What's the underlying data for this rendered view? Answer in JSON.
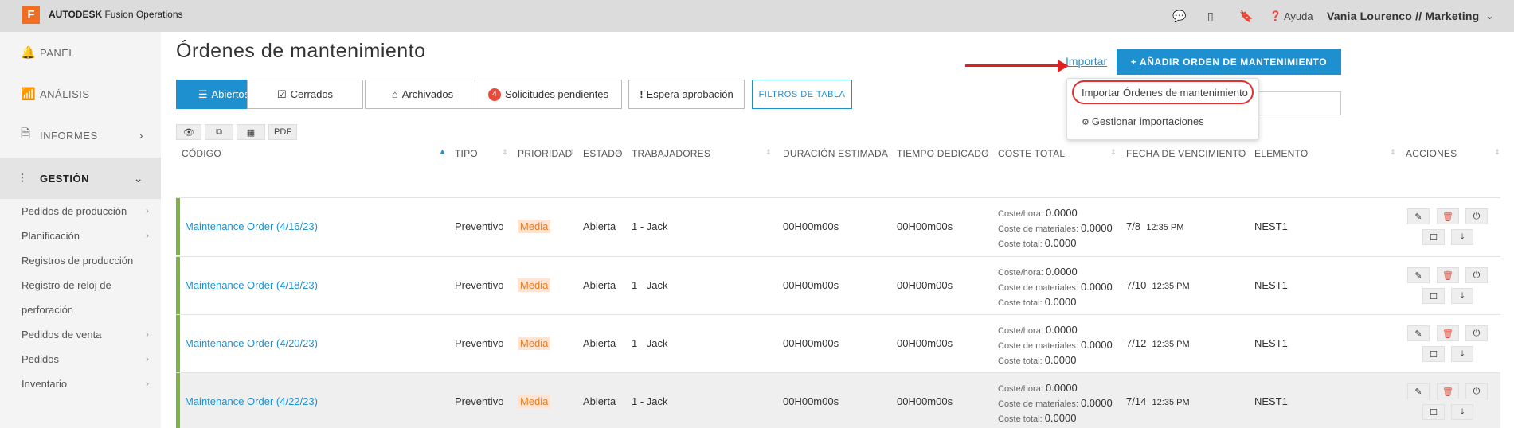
{
  "app": {
    "brand_box": "F",
    "brand": "AUTODESK",
    "product": "Fusion Operations"
  },
  "topbar": {
    "help": "Ayuda",
    "user": "Vania Lourenco // Marketing"
  },
  "sidebar": {
    "main": [
      {
        "label": "PANEL",
        "icon": "bell-icon"
      },
      {
        "label": "ANÁLISIS",
        "icon": "bar-chart-icon"
      },
      {
        "label": "INFORMES",
        "icon": "document-icon"
      },
      {
        "label": "GESTIÓN",
        "icon": "sliders-icon"
      }
    ],
    "sub": [
      "Pedidos de producción",
      "Planificación",
      "Registros de producción",
      "Registro de reloj de",
      "perforación",
      "Pedidos de venta",
      "Pedidos",
      "Inventario"
    ]
  },
  "page": {
    "title": "Órdenes de mantenimiento"
  },
  "tabs": {
    "open": "Abiertos",
    "closed": "Cerrados",
    "archived": "Archivados",
    "pending_count": "4",
    "pending": "Solicitudes pendientes",
    "approval": "Espera aprobación",
    "filters": "FILTROS DE TABLA"
  },
  "toolbar": {
    "pdf": "PDF"
  },
  "actions": {
    "import": "Importar",
    "add": "+ AÑADIR ORDEN DE MANTENIMIENTO"
  },
  "import_menu": {
    "item1": "Importar Órdenes de mantenimiento",
    "item2": "Gestionar importaciones"
  },
  "columns": [
    "CÓDIGO",
    "TIPO",
    "PRIORIDAD",
    "ESTADO",
    "TRABAJADORES",
    "DURACIÓN ESTIMADA",
    "TIEMPO DEDICADO",
    "COSTE TOTAL",
    "FECHA DE VENCIMIENTO",
    "ELEMENTO",
    "ACCIONES"
  ],
  "cost_labels": {
    "hour": "Coste/hora:",
    "materials": "Coste de materiales:",
    "total": "Coste total:"
  },
  "rows": [
    {
      "code": "Maintenance Order (4/16/23)",
      "type": "Preventivo",
      "priority": "Media",
      "status": "Abierta",
      "workers": "1 - Jack",
      "est": "00H00m00s",
      "spent": "00H00m00s",
      "cost_hour": "0.0000",
      "cost_mat": "0.0000",
      "cost_total": "0.0000",
      "due_date": "7/8",
      "due_time": "12:35 PM",
      "element": "NEST1"
    },
    {
      "code": "Maintenance Order (4/18/23)",
      "type": "Preventivo",
      "priority": "Media",
      "status": "Abierta",
      "workers": "1 - Jack",
      "est": "00H00m00s",
      "spent": "00H00m00s",
      "cost_hour": "0.0000",
      "cost_mat": "0.0000",
      "cost_total": "0.0000",
      "due_date": "7/10",
      "due_time": "12:35 PM",
      "element": "NEST1"
    },
    {
      "code": "Maintenance Order (4/20/23)",
      "type": "Preventivo",
      "priority": "Media",
      "status": "Abierta",
      "workers": "1 - Jack",
      "est": "00H00m00s",
      "spent": "00H00m00s",
      "cost_hour": "0.0000",
      "cost_mat": "0.0000",
      "cost_total": "0.0000",
      "due_date": "7/12",
      "due_time": "12:35 PM",
      "element": "NEST1"
    },
    {
      "code": "Maintenance Order (4/22/23)",
      "type": "Preventivo",
      "priority": "Media",
      "status": "Abierta",
      "workers": "1 - Jack",
      "est": "00H00m00s",
      "spent": "00H00m00s",
      "cost_hour": "0.0000",
      "cost_mat": "0.0000",
      "cost_total": "0.0000",
      "due_date": "7/14",
      "due_time": "12:35 PM",
      "element": "NEST1"
    }
  ],
  "colors": {
    "accent": "#1f90cf",
    "brand": "#f26c22",
    "row_bar": "#7cb342",
    "priority_text": "#e67e22",
    "annotation": "#e02020"
  }
}
